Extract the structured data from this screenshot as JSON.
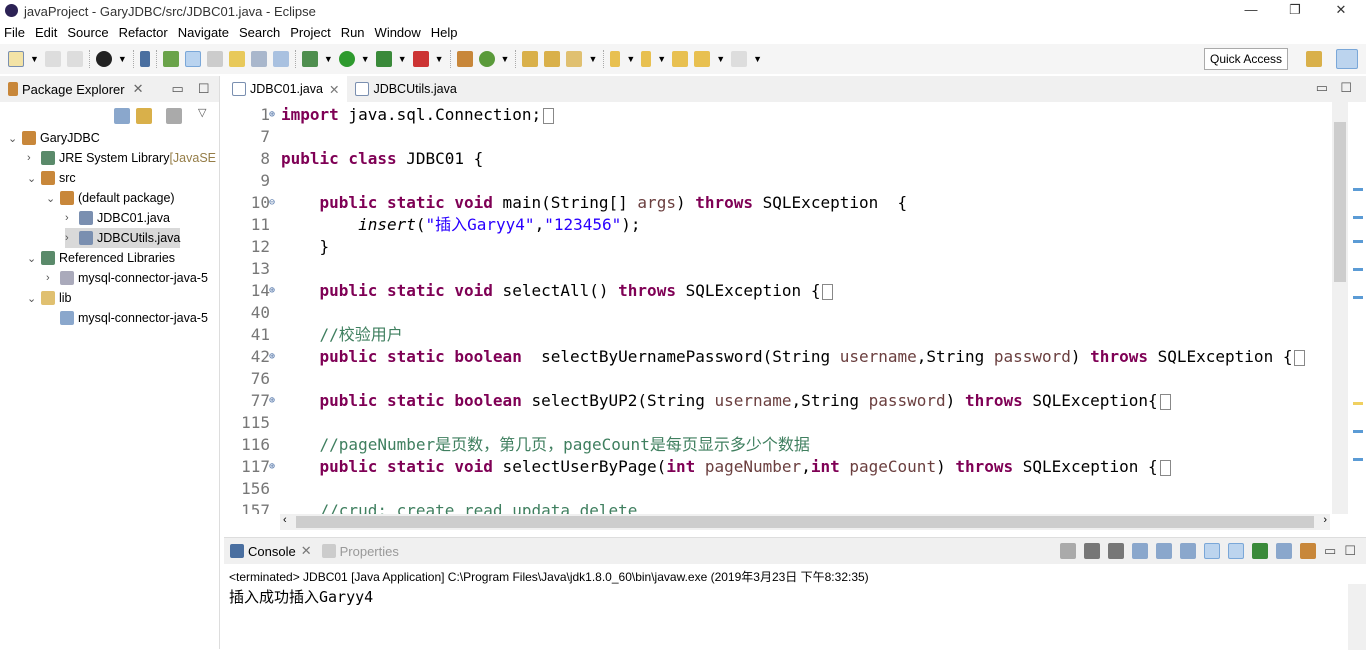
{
  "window": {
    "title": "javaProject - GaryJDBC/src/JDBC01.java - Eclipse",
    "minimize": "—",
    "restore": "❐",
    "close": "✕"
  },
  "menu": [
    "File",
    "Edit",
    "Source",
    "Refactor",
    "Navigate",
    "Search",
    "Project",
    "Run",
    "Window",
    "Help"
  ],
  "toolbar": {
    "quick_access": "Quick Access"
  },
  "package_explorer": {
    "title": "Package Explorer",
    "nodes": [
      {
        "label": "GaryJDBC",
        "level": 0,
        "expanded": true
      },
      {
        "label": "JRE System Library",
        "suffix": " [JavaSE",
        "level": 1,
        "expanded": false
      },
      {
        "label": "src",
        "level": 1,
        "expanded": true
      },
      {
        "label": "(default package)",
        "level": 2,
        "expanded": true
      },
      {
        "label": "JDBC01.java",
        "level": 3,
        "expanded": false
      },
      {
        "label": "JDBCUtils.java",
        "level": 3,
        "expanded": false,
        "selected": true
      },
      {
        "label": "Referenced Libraries",
        "level": 1,
        "expanded": true
      },
      {
        "label": "mysql-connector-java-5",
        "level": 2,
        "expanded": false
      },
      {
        "label": "lib",
        "level": 1,
        "expanded": true
      },
      {
        "label": "mysql-connector-java-5",
        "level": 2,
        "leaf": true
      }
    ]
  },
  "editor": {
    "tabs": [
      {
        "label": "JDBC01.java",
        "active": true
      },
      {
        "label": "JDBCUtils.java",
        "active": false
      }
    ],
    "lines": [
      {
        "n": "1",
        "fold": "⊕",
        "segs": [
          [
            "import",
            "kw"
          ],
          [
            " java.sql.Connection;",
            ""
          ],
          [
            "…",
            "box"
          ]
        ]
      },
      {
        "n": "7",
        "segs": []
      },
      {
        "n": "8",
        "segs": [
          [
            "public class",
            "kw"
          ],
          [
            " JDBC01 {",
            ""
          ]
        ]
      },
      {
        "n": "9",
        "segs": []
      },
      {
        "n": "10",
        "fold": "⊖",
        "segs": [
          [
            "    ",
            ""
          ],
          [
            "public static void",
            "kw"
          ],
          [
            " main(String[] ",
            ""
          ],
          [
            "args",
            "par"
          ],
          [
            ") ",
            ""
          ],
          [
            "throws",
            "kw"
          ],
          [
            " SQLException  {",
            ""
          ]
        ]
      },
      {
        "n": "11",
        "segs": [
          [
            "        ",
            ""
          ],
          [
            "insert",
            "it"
          ],
          [
            "(",
            ""
          ],
          [
            "\"插入Garyy4\"",
            "str"
          ],
          [
            ",",
            ""
          ],
          [
            "\"123456\"",
            "str"
          ],
          [
            ");",
            ""
          ]
        ]
      },
      {
        "n": "12",
        "segs": [
          [
            "    }",
            ""
          ]
        ]
      },
      {
        "n": "13",
        "segs": []
      },
      {
        "n": "14",
        "fold": "⊕",
        "segs": [
          [
            "    ",
            ""
          ],
          [
            "public static void",
            "kw"
          ],
          [
            " selectAll() ",
            ""
          ],
          [
            "throws",
            "kw"
          ],
          [
            " SQLException {",
            ""
          ],
          [
            "…",
            "box"
          ]
        ]
      },
      {
        "n": "40",
        "segs": []
      },
      {
        "n": "41",
        "segs": [
          [
            "    //校验用户",
            "cm"
          ]
        ]
      },
      {
        "n": "42",
        "fold": "⊕",
        "segs": [
          [
            "    ",
            ""
          ],
          [
            "public static boolean",
            "kw"
          ],
          [
            "  selectByUernamePassword(String ",
            ""
          ],
          [
            "username",
            "par"
          ],
          [
            ",String ",
            ""
          ],
          [
            "password",
            "par"
          ],
          [
            ") ",
            ""
          ],
          [
            "throws",
            "kw"
          ],
          [
            " SQLException {",
            ""
          ],
          [
            "…",
            "box"
          ]
        ]
      },
      {
        "n": "76",
        "segs": []
      },
      {
        "n": "77",
        "fold": "⊕",
        "segs": [
          [
            "    ",
            ""
          ],
          [
            "public static boolean",
            "kw"
          ],
          [
            " selectByUP2(String ",
            ""
          ],
          [
            "username",
            "par"
          ],
          [
            ",String ",
            ""
          ],
          [
            "password",
            "par"
          ],
          [
            ") ",
            ""
          ],
          [
            "throws",
            "kw"
          ],
          [
            " SQLException{",
            ""
          ],
          [
            "…",
            "box"
          ]
        ]
      },
      {
        "n": "115",
        "segs": []
      },
      {
        "n": "116",
        "segs": [
          [
            "    //pageNumber是页数，第几页，pageCount是每页显示多少个数据",
            "cm"
          ]
        ]
      },
      {
        "n": "117",
        "fold": "⊕",
        "segs": [
          [
            "    ",
            ""
          ],
          [
            "public static void",
            "kw"
          ],
          [
            " selectUserByPage(",
            ""
          ],
          [
            "int",
            "kw"
          ],
          [
            " ",
            ""
          ],
          [
            "pageNumber",
            "par"
          ],
          [
            ",",
            ""
          ],
          [
            "int",
            "kw"
          ],
          [
            " ",
            ""
          ],
          [
            "pageCount",
            "par"
          ],
          [
            ") ",
            ""
          ],
          [
            "throws",
            "kw"
          ],
          [
            " SQLException {",
            ""
          ],
          [
            "…",
            "box"
          ]
        ]
      },
      {
        "n": "156",
        "segs": []
      },
      {
        "n": "157",
        "segs": [
          [
            "    //crud: create read updata delete",
            "cm"
          ]
        ]
      }
    ]
  },
  "console": {
    "tabs": [
      {
        "label": "Console",
        "active": true
      },
      {
        "label": "Properties",
        "active": false
      }
    ],
    "status": "<terminated> JDBC01 [Java Application] C:\\Program Files\\Java\\jdk1.8.0_60\\bin\\javaw.exe (2019年3月23日 下午8:32:35)",
    "output": "插入成功插入Garyy4"
  },
  "colors": {
    "keyword": "#7f0055",
    "string": "#2a00ff",
    "comment": "#3f7f5f",
    "param": "#6a3e3e"
  }
}
